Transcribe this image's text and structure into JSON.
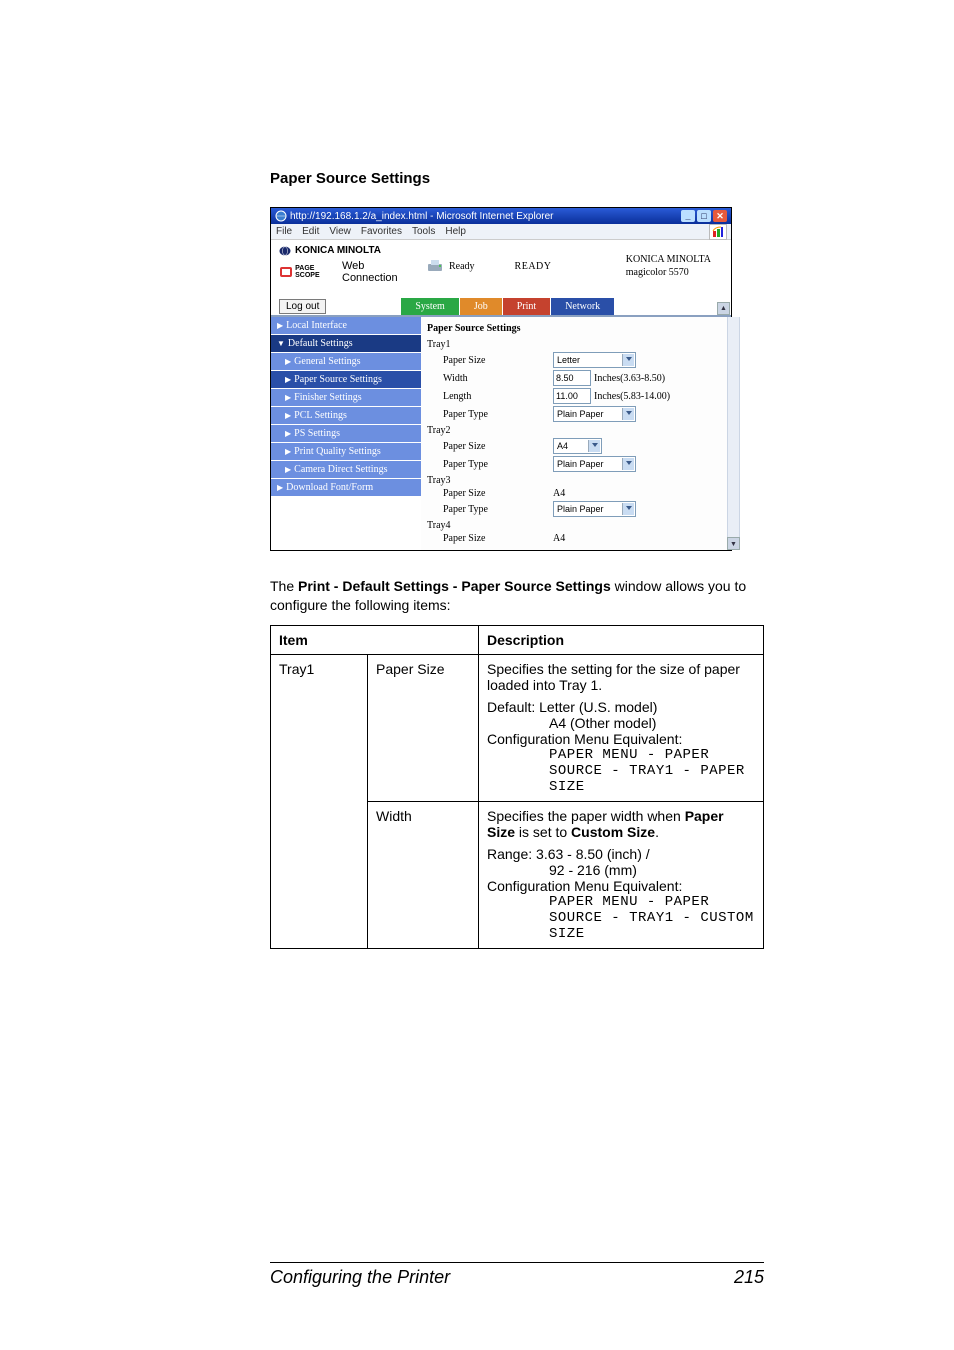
{
  "section_heading": "Paper Source Settings",
  "browser": {
    "title": "http://192.168.1.2/a_index.html - Microsoft Internet Explorer",
    "menus": [
      "File",
      "Edit",
      "View",
      "Favorites",
      "Tools",
      "Help"
    ]
  },
  "header": {
    "brand": "KONICA MINOLTA",
    "subbrand_small": "PAGE SCOPE",
    "subbrand": "Web Connection",
    "status_label": "Ready",
    "status_word": "READY",
    "model_line1": "KONICA MINOLTA",
    "model_line2": "magicolor 5570",
    "logout": "Log out"
  },
  "tabs": [
    "System",
    "Job",
    "Print",
    "Network"
  ],
  "sidebar": [
    {
      "label": "Local Interface",
      "cls": "side-item light",
      "arrow": "▶"
    },
    {
      "label": "Default Settings",
      "cls": "side-item dark",
      "arrow": "▼"
    },
    {
      "label": "General Settings",
      "cls": "side-item sub light2",
      "arrow": "▶"
    },
    {
      "label": "Paper Source Settings",
      "cls": "side-item sub",
      "arrow": "▶"
    },
    {
      "label": "Finisher Settings",
      "cls": "side-item sub light2",
      "arrow": "▶"
    },
    {
      "label": "PCL Settings",
      "cls": "side-item sub light2",
      "arrow": "▶"
    },
    {
      "label": "PS Settings",
      "cls": "side-item sub light2",
      "arrow": "▶"
    },
    {
      "label": "Print Quality Settings",
      "cls": "side-item sub light2",
      "arrow": "▶"
    },
    {
      "label": "Camera Direct Settings",
      "cls": "side-item sub light2",
      "arrow": "▶"
    },
    {
      "label": "Download Font/Form",
      "cls": "side-item light",
      "arrow": "▶"
    }
  ],
  "content": {
    "heading": "Paper Source Settings",
    "tray1": {
      "title": "Tray1",
      "rows": {
        "paper_size": {
          "label": "Paper Size",
          "value": "Letter"
        },
        "width": {
          "label": "Width",
          "value": "8.50",
          "hint": "Inches(3.63-8.50)"
        },
        "length": {
          "label": "Length",
          "value": "11.00",
          "hint": "Inches(5.83-14.00)"
        },
        "paper_type": {
          "label": "Paper Type",
          "value": "Plain Paper"
        }
      }
    },
    "tray2": {
      "title": "Tray2",
      "rows": {
        "paper_size": {
          "label": "Paper Size",
          "value": "A4"
        },
        "paper_type": {
          "label": "Paper Type",
          "value": "Plain Paper"
        }
      }
    },
    "tray3": {
      "title": "Tray3",
      "rows": {
        "paper_size": {
          "label": "Paper Size",
          "value": "A4"
        },
        "paper_type": {
          "label": "Paper Type",
          "value": "Plain Paper"
        }
      }
    },
    "tray4": {
      "title": "Tray4",
      "rows": {
        "paper_size": {
          "label": "Paper Size",
          "value": "A4"
        }
      }
    }
  },
  "paragraph": {
    "pre": "The ",
    "bold": "Print - Default Settings - Paper Source Settings",
    "post": " window allows you to configure the following items:"
  },
  "table": {
    "head": {
      "item": "Item",
      "desc": "Description"
    },
    "c1": "Tray1",
    "r1": {
      "item2": "Paper Size",
      "p1": "Specifies the setting for the size of paper loaded into Tray 1.",
      "d1": "Default:  Letter (U.S. model)",
      "d1b": "A4 (Other model)",
      "d2": "Configuration Menu Equivalent:",
      "d3": "PAPER MENU - PAPER SOURCE - TRAY1 - PAPER SIZE"
    },
    "r2": {
      "item2": "Width",
      "p1a": "Specifies the paper width when ",
      "p1b": "Paper Size",
      "p1c": " is set to ",
      "p1d": "Custom Size",
      "p1e": ".",
      "r1": "Range:   3.63 - 8.50 (inch) /",
      "r1b": "92 - 216 (mm)",
      "d2": "Configuration Menu Equivalent:",
      "d3": "PAPER MENU - PAPER SOURCE - TRAY1 - CUSTOM SIZE"
    }
  },
  "footer": {
    "title": "Configuring the Printer",
    "page": "215"
  }
}
